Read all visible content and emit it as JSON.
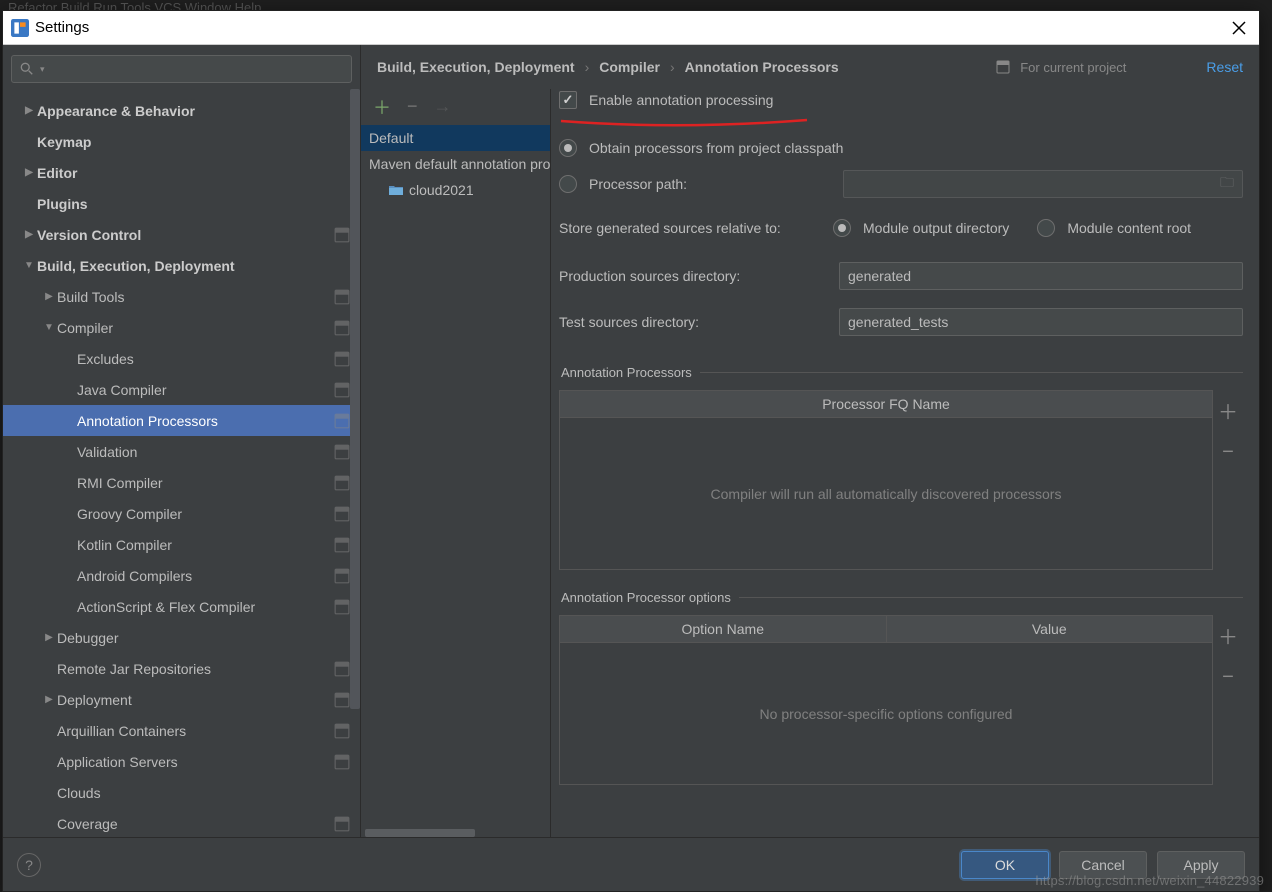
{
  "bg_menu": "Refactor   Build   Run   Tools   VCS   Window   Help",
  "window": {
    "title": "Settings"
  },
  "sidebar": {
    "search_placeholder": "",
    "items": [
      {
        "label": "Appearance & Behavior",
        "level": 0,
        "arrow": "▶",
        "bold": true,
        "badge": false
      },
      {
        "label": "Keymap",
        "level": 0,
        "arrow": "",
        "bold": true,
        "badge": false
      },
      {
        "label": "Editor",
        "level": 0,
        "arrow": "▶",
        "bold": true,
        "badge": false
      },
      {
        "label": "Plugins",
        "level": 0,
        "arrow": "",
        "bold": true,
        "badge": false
      },
      {
        "label": "Version Control",
        "level": 0,
        "arrow": "▶",
        "bold": true,
        "badge": true
      },
      {
        "label": "Build, Execution, Deployment",
        "level": 0,
        "arrow": "▼",
        "bold": true,
        "badge": false
      },
      {
        "label": "Build Tools",
        "level": 1,
        "arrow": "▶",
        "bold": false,
        "badge": true
      },
      {
        "label": "Compiler",
        "level": 1,
        "arrow": "▼",
        "bold": false,
        "badge": true
      },
      {
        "label": "Excludes",
        "level": 2,
        "arrow": "",
        "bold": false,
        "badge": true
      },
      {
        "label": "Java Compiler",
        "level": 2,
        "arrow": "",
        "bold": false,
        "badge": true
      },
      {
        "label": "Annotation Processors",
        "level": 2,
        "arrow": "",
        "bold": false,
        "badge": true,
        "selected": true
      },
      {
        "label": "Validation",
        "level": 2,
        "arrow": "",
        "bold": false,
        "badge": true
      },
      {
        "label": "RMI Compiler",
        "level": 2,
        "arrow": "",
        "bold": false,
        "badge": true
      },
      {
        "label": "Groovy Compiler",
        "level": 2,
        "arrow": "",
        "bold": false,
        "badge": true
      },
      {
        "label": "Kotlin Compiler",
        "level": 2,
        "arrow": "",
        "bold": false,
        "badge": true
      },
      {
        "label": "Android Compilers",
        "level": 2,
        "arrow": "",
        "bold": false,
        "badge": true
      },
      {
        "label": "ActionScript & Flex Compiler",
        "level": 2,
        "arrow": "",
        "bold": false,
        "badge": true
      },
      {
        "label": "Debugger",
        "level": 1,
        "arrow": "▶",
        "bold": false,
        "badge": false
      },
      {
        "label": "Remote Jar Repositories",
        "level": 1,
        "arrow": "",
        "bold": false,
        "badge": true
      },
      {
        "label": "Deployment",
        "level": 1,
        "arrow": "▶",
        "bold": false,
        "badge": true
      },
      {
        "label": "Arquillian Containers",
        "level": 1,
        "arrow": "",
        "bold": false,
        "badge": true
      },
      {
        "label": "Application Servers",
        "level": 1,
        "arrow": "",
        "bold": false,
        "badge": true
      },
      {
        "label": "Clouds",
        "level": 1,
        "arrow": "",
        "bold": false,
        "badge": false
      },
      {
        "label": "Coverage",
        "level": 1,
        "arrow": "",
        "bold": false,
        "badge": true
      }
    ]
  },
  "profiles": {
    "items": [
      {
        "label": "Default",
        "selected": true,
        "indent": 0,
        "folder": false
      },
      {
        "label": "Maven default annotation processors profile",
        "selected": false,
        "indent": 0,
        "folder": false
      },
      {
        "label": "cloud2021",
        "selected": false,
        "indent": 1,
        "folder": true
      }
    ]
  },
  "breadcrumb": {
    "c1": "Build, Execution, Deployment",
    "c2": "Compiler",
    "c3": "Annotation Processors",
    "project_label": "For current project",
    "reset": "Reset"
  },
  "form": {
    "enable_label": "Enable annotation processing",
    "enable_checked": true,
    "obtain_label": "Obtain processors from project classpath",
    "obtain_selected": true,
    "path_label": "Processor path:",
    "path_value": "",
    "store_label": "Store generated sources relative to:",
    "module_out_label": "Module output directory",
    "module_out_selected": true,
    "module_content_label": "Module content root",
    "module_content_selected": false,
    "prod_label": "Production sources directory:",
    "prod_value": "generated",
    "test_label": "Test sources directory:",
    "test_value": "generated_tests"
  },
  "processors_group": {
    "legend": "Annotation Processors",
    "col1": "Processor FQ Name",
    "empty": "Compiler will run all automatically discovered processors"
  },
  "options_group": {
    "legend": "Annotation Processor options",
    "col1": "Option Name",
    "col2": "Value",
    "empty": "No processor-specific options configured"
  },
  "footer": {
    "ok": "OK",
    "cancel": "Cancel",
    "apply": "Apply"
  },
  "watermark": "https://blog.csdn.net/weixin_44822939"
}
